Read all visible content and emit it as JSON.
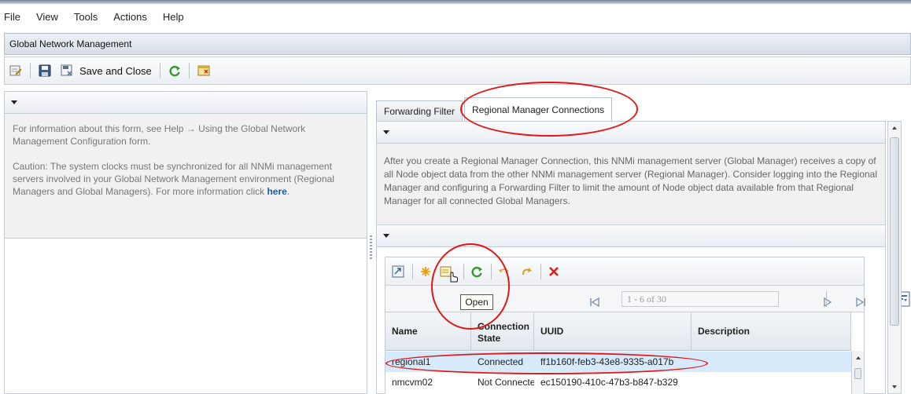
{
  "menubar": {
    "items": [
      "File",
      "View",
      "Tools",
      "Actions",
      "Help"
    ]
  },
  "window": {
    "title": "Global Network Management"
  },
  "toolbar": {
    "save_close_label": "Save and Close"
  },
  "left_panel": {
    "info_line1": "For information about this form, see Help → Using the Global Network Management Configuration form.",
    "caution": "Caution: The system clocks must be synchronized for all NNMi management servers involved in your Global Network Management environment (Regional Managers and Global Managers). For more information click ",
    "link_text": "here",
    "link_suffix": "."
  },
  "tabs": [
    "Forwarding Filter",
    "Regional Manager Connections"
  ],
  "right_panel": {
    "info": "After you create a Regional Manager Connection, this NNMi management server (Global Manager) receives a copy of all Node object data from the other NNMi management server (Regional Manager). Consider logging into the Regional Manager and configuring a Forwarding Filter to limit the amount of Node object data available from that Regional Manager for all connected Global Managers."
  },
  "table": {
    "tooltip": "Open",
    "pager_text": "1 - 6 of 30",
    "columns": [
      "Name",
      "Connection State",
      "UUID",
      "Description"
    ],
    "rows": [
      {
        "name": "regional1",
        "state": "Connected",
        "uuid": "ff1b160f-feb3-43e8-9335-a017b",
        "description": ""
      },
      {
        "name": "nmcvm02",
        "state": "Not Connecte",
        "uuid": "ec150190-410c-47b3-b847-b329",
        "description": ""
      }
    ]
  },
  "colors": {
    "annotation": "#e11616",
    "selected_row": "#d6eafb",
    "link": "#1a5ea8"
  }
}
